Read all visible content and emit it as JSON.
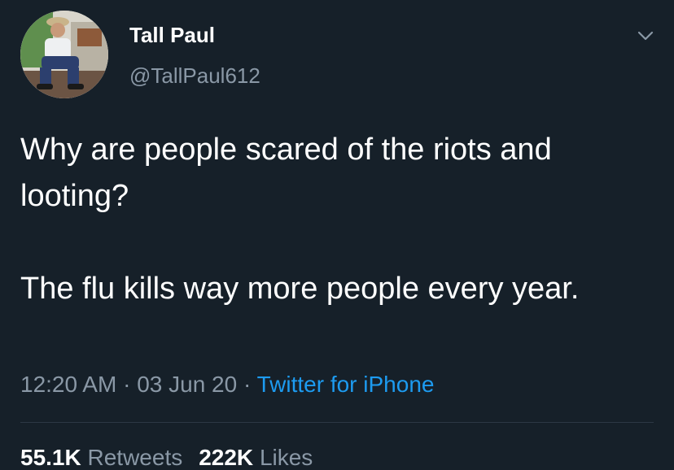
{
  "author": {
    "display_name": "Tall Paul",
    "handle": "@TallPaul612",
    "avatar_icon": "profile-photo"
  },
  "menu_icon": "chevron-down-icon",
  "tweet": {
    "paragraphs": [
      "Why are people scared of the riots and looting?",
      "The flu kills way more people every year."
    ]
  },
  "meta": {
    "time": "12:20 AM",
    "separator": "·",
    "date": "03 Jun 20",
    "source": "Twitter for iPhone"
  },
  "stats": {
    "retweets_count": "55.1K",
    "retweets_label": "Retweets",
    "likes_count": "222K",
    "likes_label": "Likes"
  },
  "colors": {
    "background": "#162029",
    "primary_text": "#ffffff",
    "secondary_text": "#8a98a6",
    "link": "#1d9bf0"
  }
}
